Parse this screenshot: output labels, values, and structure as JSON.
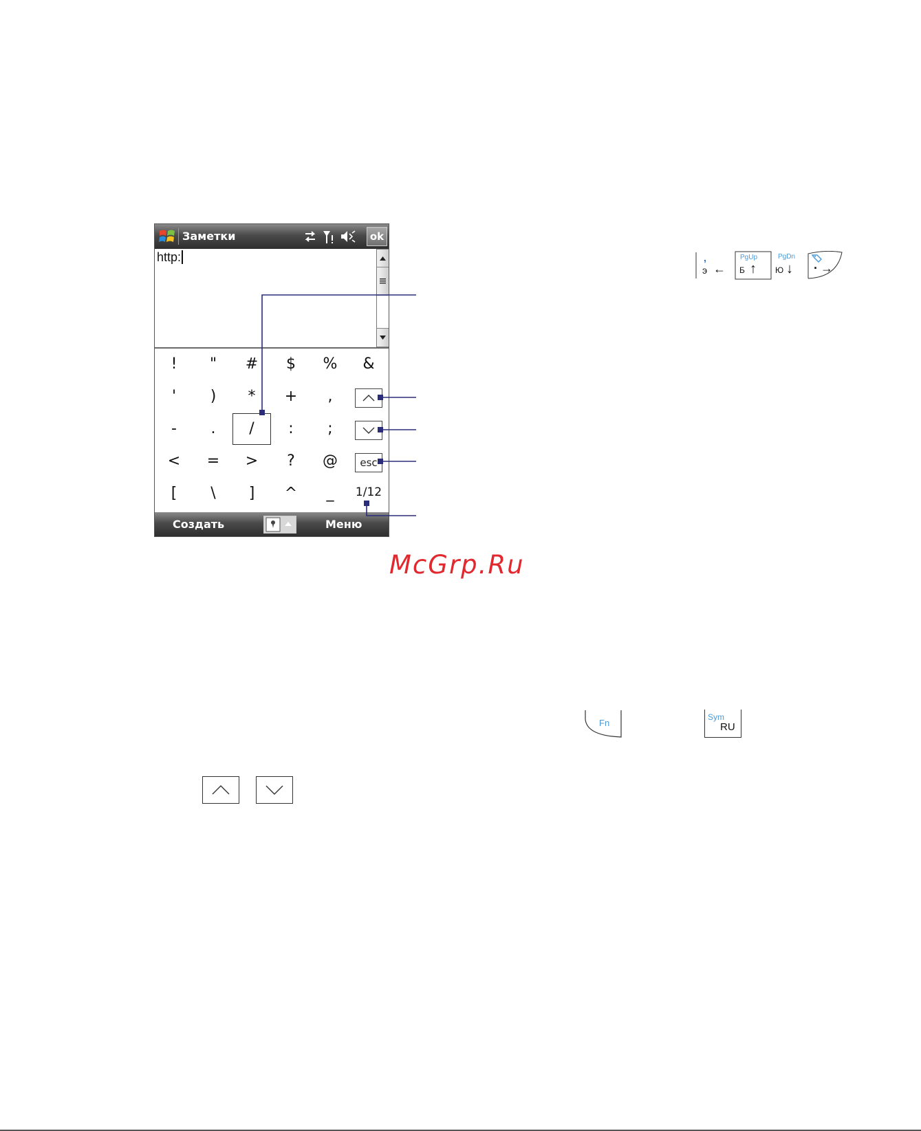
{
  "device": {
    "app_title": "Заметки",
    "ok_label": "ok",
    "typed_text": "http:",
    "softkey_left": "Создать",
    "softkey_right": "Меню",
    "status_icons": [
      "connectivity-icon",
      "signal-icon",
      "speaker-mute-icon"
    ]
  },
  "symbol_pad": {
    "rows": [
      [
        "!",
        "\"",
        "#",
        "$",
        "%",
        "&"
      ],
      [
        "'",
        ")",
        "*",
        "+",
        ","
      ],
      [
        "-",
        ".",
        "/",
        ":",
        ";"
      ],
      [
        "<",
        "=",
        ">",
        "?",
        "@"
      ],
      [
        "[",
        "\\",
        "]",
        "^",
        "_"
      ]
    ],
    "selected": "/",
    "escape_label": "esc",
    "page_indicator": "1/12"
  },
  "hardware_keys": {
    "top_keys": [
      {
        "top": ",",
        "bottom": "э",
        "arrow": "←"
      },
      {
        "top": "PgUp",
        "bottom": "Б",
        "arrow": "↑"
      },
      {
        "top": "PgDn",
        "bottom": "Ю",
        "arrow": "↓"
      },
      {
        "top": "",
        "bottom": "·",
        "arrow": "→"
      }
    ],
    "fn_label": "Fn",
    "sym_label": "Sym",
    "ru_label": "RU"
  },
  "watermark": "McGrp.Ru",
  "colors": {
    "callout_line": "#2b2d7a",
    "key_accent": "#4a9ad8",
    "watermark": "#e0282e"
  }
}
